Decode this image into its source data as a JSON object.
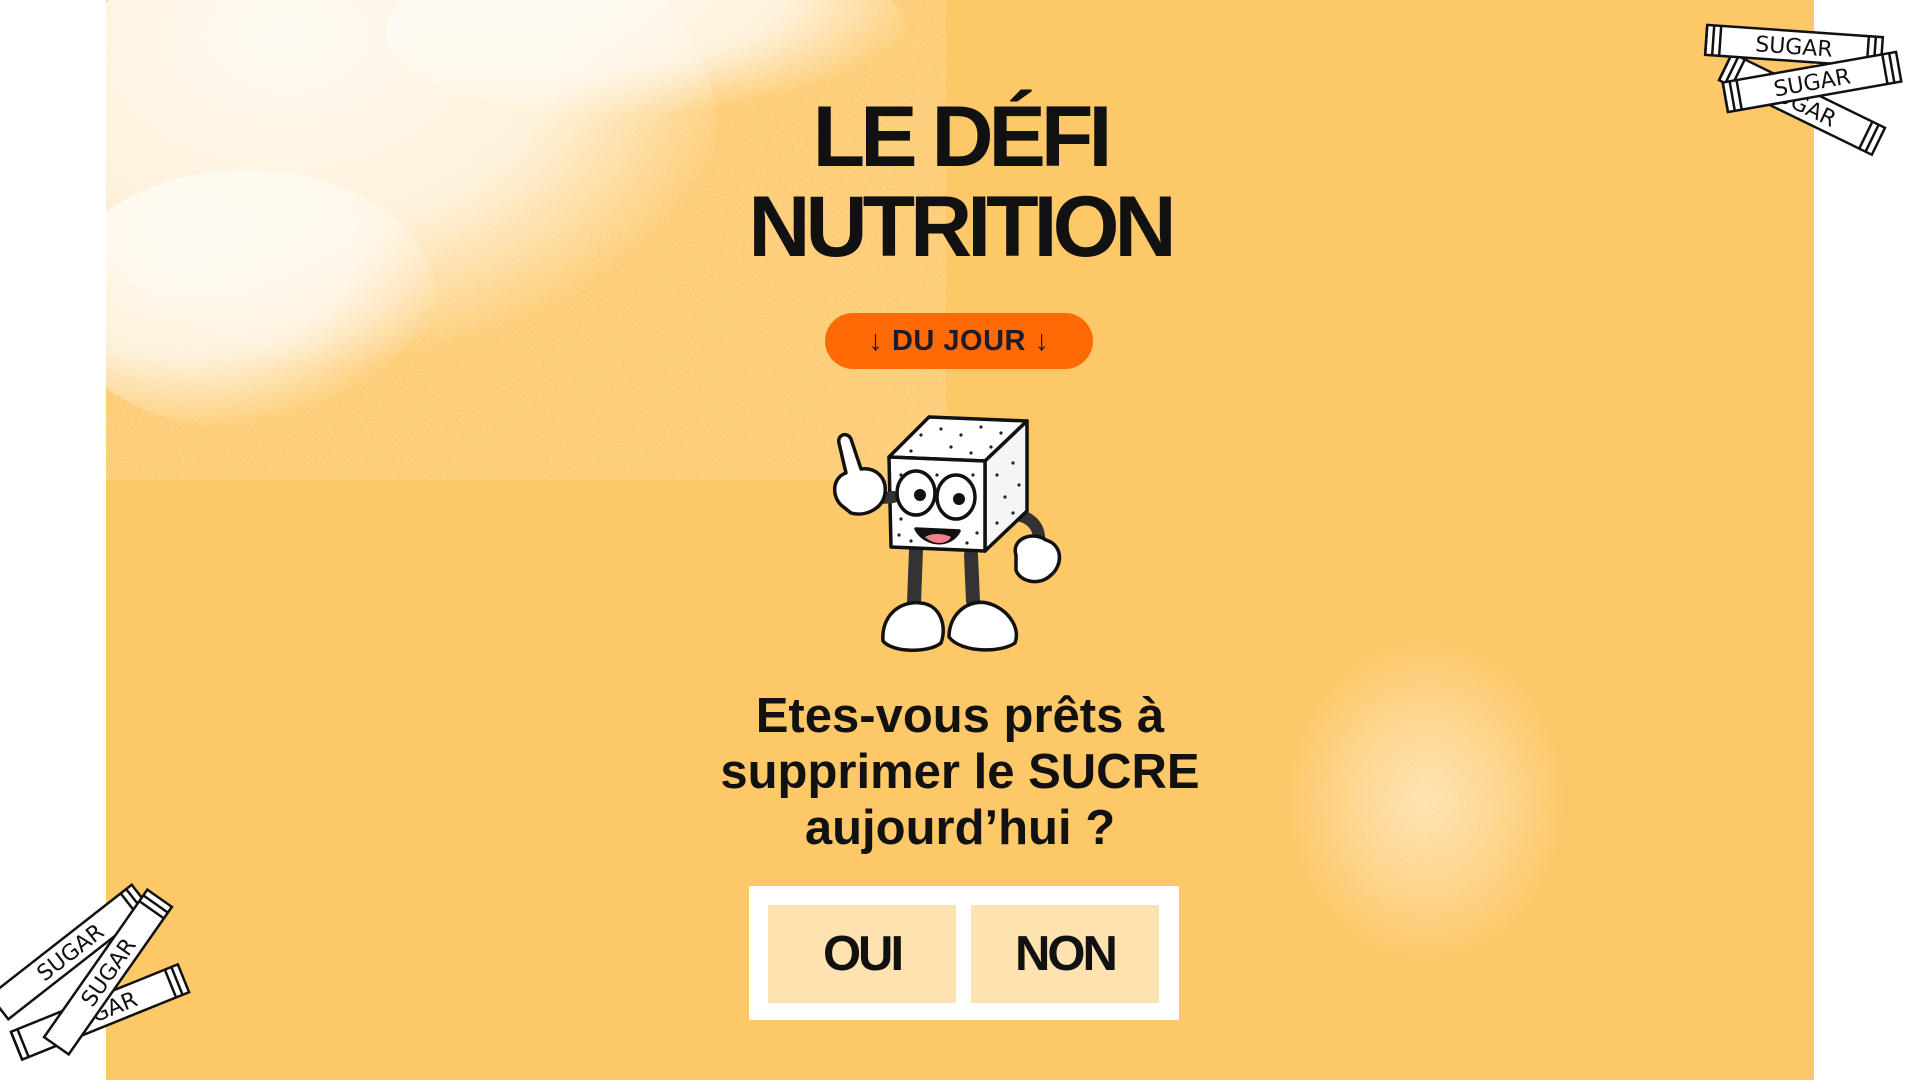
{
  "title": {
    "line1": "LE DÉFI",
    "line2": "NUTRITION"
  },
  "badge": {
    "label": "↓ DU JOUR ↓"
  },
  "question": {
    "line1": "Etes-vous prêts à",
    "line2": "supprimer le SUCRE",
    "line3": "aujourd’hui ?"
  },
  "choices": {
    "yes_label": "OUI",
    "no_label": "NON"
  },
  "stickers": {
    "packet_text": "SUGAR"
  },
  "colors": {
    "background": "#fdc868",
    "badge": "#ff6a06",
    "choice_fill": "#fee3b0",
    "text": "#111111"
  },
  "icons": [
    "sugar-cube-mascot-icon",
    "sugar-packet-icon",
    "arrow-down-icon"
  ]
}
